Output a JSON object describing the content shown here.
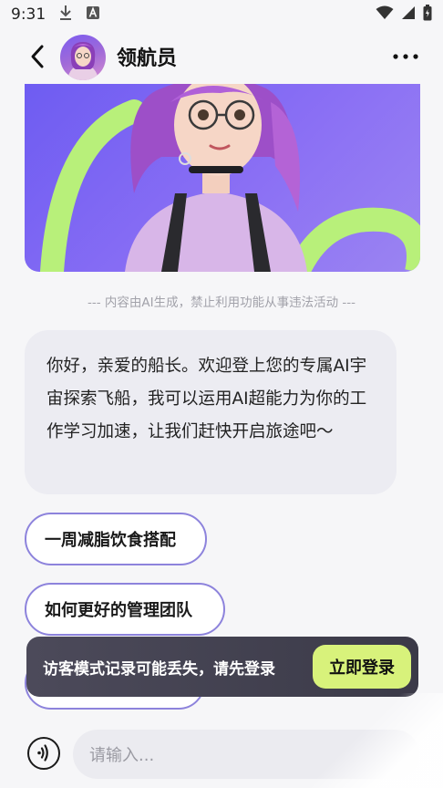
{
  "status_bar": {
    "time": "9:31",
    "icons": [
      "download-icon",
      "font-a-icon",
      "wifi-icon",
      "signal-icon",
      "battery-icon"
    ]
  },
  "header": {
    "title": "领航员",
    "back_icon": "chevron-left-icon",
    "more_icon": "more-icon"
  },
  "disclaimer": "--- 内容由AI生成，禁止利用功能从事违法活动 ---",
  "welcome_message": "你好，亲爱的船长。欢迎登上您的专属AI宇宙探索飞船，我可以运用AI超能力为你的工作学习加速，让我们赶快开启旅途吧～",
  "suggestions": [
    {
      "label": "一周减脂饮食搭配"
    },
    {
      "label": "如何更好的管理团队"
    },
    {
      "label": ""
    }
  ],
  "toast": {
    "text": "访客模式记录可能丢失，请先登录",
    "button_label": "立即登录"
  },
  "input": {
    "placeholder": "请输入..."
  },
  "colors": {
    "accent_lime": "#d8f27b",
    "chip_border": "#8d83dc",
    "hero_purple": "#7b63f2",
    "bubble_bg": "#ececf2"
  }
}
